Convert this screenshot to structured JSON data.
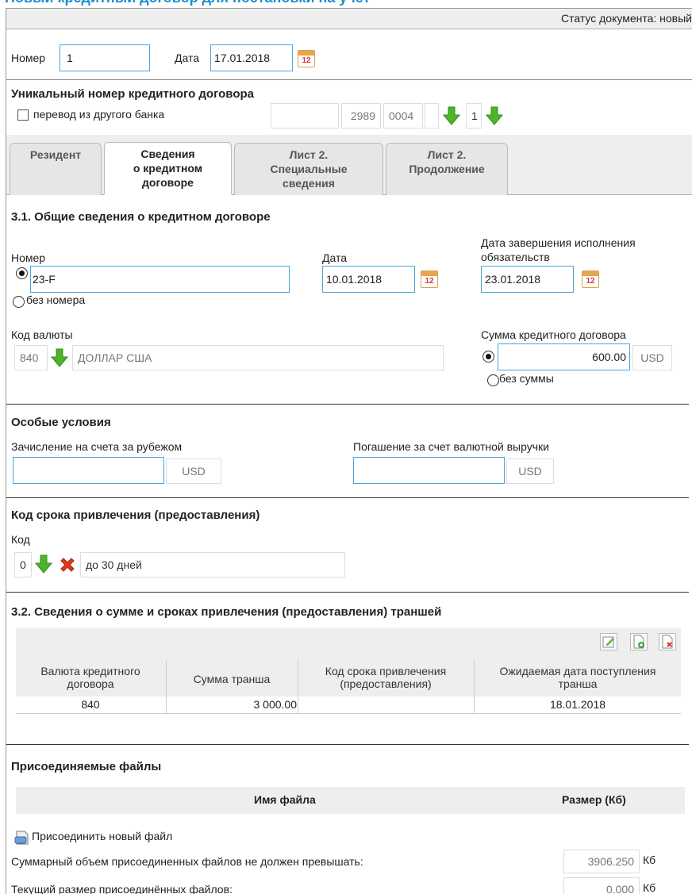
{
  "page": {
    "title": "Новый кредитный договор для постановки на учет"
  },
  "status": {
    "label": "Статус документа: новый"
  },
  "header": {
    "number_label": "Номер",
    "number_value": "1",
    "date_label": "Дата",
    "date_value": "17.01.2018",
    "calendar_text": "12"
  },
  "unique": {
    "title": "Уникальный номер кредитного договора",
    "transfer_label": "перевод из другого банка",
    "field1": "",
    "field2": "2989",
    "field3": "0004",
    "field4": "",
    "field5": "1"
  },
  "tabs": [
    {
      "line1": "Резидент",
      "line2": "",
      "line3": ""
    },
    {
      "line1": "Сведения",
      "line2": "о кредитном",
      "line3": "договоре"
    },
    {
      "line1": "Лист 2.",
      "line2": "Специальные",
      "line3": "сведения"
    },
    {
      "line1": "Лист 2.",
      "line2": "Продолжение",
      "line3": ""
    }
  ],
  "general": {
    "title": "3.1. Общие сведения о кредитном договоре",
    "number_label": "Номер",
    "number_value": "23-F",
    "no_number_label": "без номера",
    "date_label": "Дата",
    "date_value": "10.01.2018",
    "end_date_label_1": "Дата завершения исполнения",
    "end_date_label_2": "обязательств",
    "end_date_value": "23.01.2018",
    "currency_label": "Код валюты",
    "currency_code": "840",
    "currency_name": "ДОЛЛАР США",
    "sum_label": "Сумма кредитного договора",
    "sum_value": "600.00",
    "sum_currency": "USD",
    "no_sum_label": "без суммы"
  },
  "special": {
    "title": "Особые условия",
    "abroad_label": "Зачисление на счета за рубежом",
    "abroad_value": "",
    "abroad_currency": "USD",
    "repay_label": "Погашение за счет валютной выручки",
    "repay_value": "",
    "repay_currency": "USD"
  },
  "term": {
    "title": "Код срока привлечения (предоставления)",
    "code_label": "Код",
    "code_value": "0",
    "code_name": "до 30 дней"
  },
  "tranches": {
    "title": "3.2. Сведения о сумме и сроках привлечения (предоставления) траншей",
    "headers": [
      "Валюта кредитного договора",
      "Сумма транша",
      "Код срока привлечения (предоставления)",
      "Ожидаемая дата поступления транша"
    ],
    "headers_split": [
      [
        "Валюта кредитного",
        "договора"
      ],
      [
        "Сумма транша",
        ""
      ],
      [
        "Код срока привлечения",
        "(предоставления)"
      ],
      [
        "Ожидаемая дата поступления",
        "транша"
      ]
    ],
    "rows": [
      {
        "currency": "840",
        "amount": "3 000.00",
        "term_code": "",
        "expected_date": "18.01.2018"
      }
    ]
  },
  "files": {
    "title": "Присоединяемые файлы",
    "col_name": "Имя файла",
    "col_size": "Размер (Кб)",
    "attach_label": "Присоединить новый файл",
    "limit_label": "Суммарный объем присоединенных файлов не должен превышать:",
    "limit_value": "3906.250",
    "limit_unit": "Кб",
    "current_label": "Текущий размер присоединённых файлов:",
    "current_value": "0.000",
    "current_unit": "Кб"
  },
  "colors": {
    "accent": "#1a8fce",
    "input_border": "#4aa3df",
    "arrow_green": "#4cb52a",
    "delete_red": "#e23a1a"
  }
}
